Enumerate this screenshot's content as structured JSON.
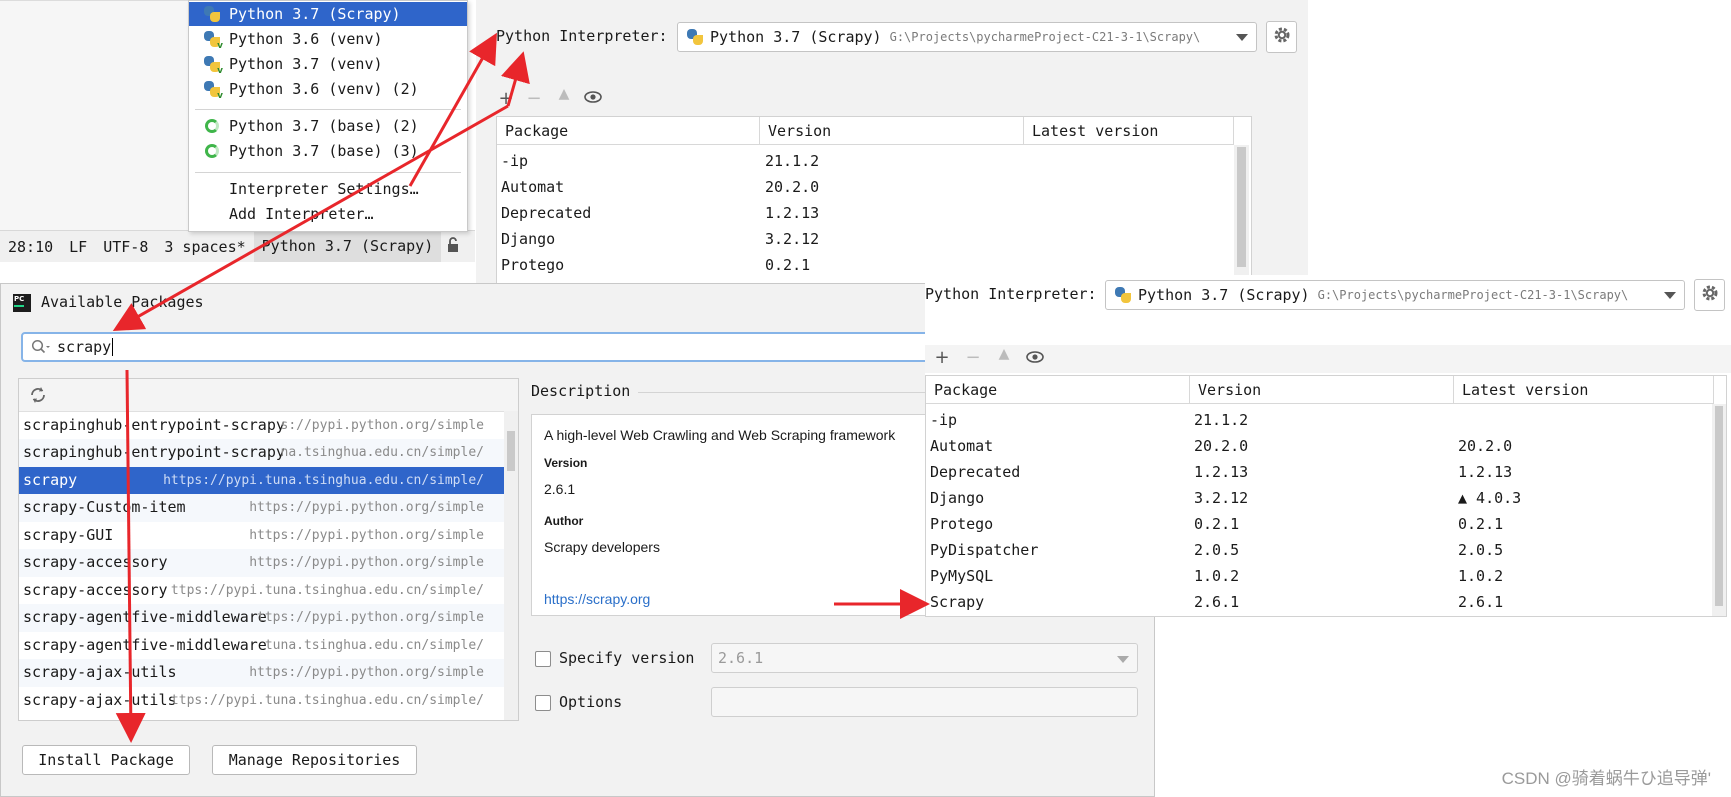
{
  "status_bar": {
    "position": "28:10",
    "line_sep": "LF",
    "encoding": "UTF-8",
    "indent": "3 spaces*",
    "interpreter": "Python 3.7 (Scrapy)"
  },
  "interpreter_menu": {
    "items": [
      {
        "label": "Python 3.7 (Scrapy)",
        "icon": "python-icon",
        "selected": true
      },
      {
        "label": "Python 3.6 (venv)",
        "icon": "python-venv-icon"
      },
      {
        "label": "Python 3.7 (venv)",
        "icon": "python-venv-icon"
      },
      {
        "label": "Python 3.6 (venv) (2)",
        "icon": "python-venv-icon"
      },
      {
        "label": "Python 3.7 (base) (2)",
        "icon": "conda-icon"
      },
      {
        "label": "Python 3.7 (base) (3)",
        "icon": "conda-icon"
      }
    ],
    "settings_label": "Interpreter Settings…",
    "add_label": "Add Interpreter…"
  },
  "settings_top": {
    "label": "Python Interpreter:",
    "interpreter": "Python 3.7 (Scrapy)",
    "path": "G:\\Projects\\pycharmeProject-C21-3-1\\Scrapy\\",
    "columns": [
      "Package",
      "Version",
      "Latest version"
    ],
    "rows": [
      {
        "name": "-ip",
        "version": "21.1.2",
        "latest": ""
      },
      {
        "name": "Automat",
        "version": "20.2.0",
        "latest": ""
      },
      {
        "name": "Deprecated",
        "version": "1.2.13",
        "latest": ""
      },
      {
        "name": "Django",
        "version": "3.2.12",
        "latest": ""
      },
      {
        "name": "Protego",
        "version": "0.2.1",
        "latest": ""
      }
    ]
  },
  "available_packages": {
    "title": "Available Packages",
    "search_value": "scrapy",
    "packages": [
      {
        "name": "scrapinghub-entrypoint-scrapy",
        "repo": "s://pypi.python.org/simple"
      },
      {
        "name": "scrapinghub-entrypoint-scrapy",
        "repo": "na.tsinghua.edu.cn/simple/"
      },
      {
        "name": "scrapy",
        "repo": "https://pypi.tuna.tsinghua.edu.cn/simple/"
      },
      {
        "name": "scrapy-Custom-item",
        "repo": "https://pypi.python.org/simple"
      },
      {
        "name": "scrapy-GUI",
        "repo": "https://pypi.python.org/simple"
      },
      {
        "name": "scrapy-accessory",
        "repo": "https://pypi.python.org/simple"
      },
      {
        "name": "scrapy-accessory",
        "repo": "ttps://pypi.tuna.tsinghua.edu.cn/simple/"
      },
      {
        "name": "scrapy-agentfive-middleware",
        "repo": "ttps://pypi.python.org/simple"
      },
      {
        "name": "scrapy-agentfive-middleware",
        "repo": "tuna.tsinghua.edu.cn/simple/"
      },
      {
        "name": "scrapy-ajax-utils",
        "repo": "https://pypi.python.org/simple"
      },
      {
        "name": "scrapy-ajax-utils",
        "repo": "ttps://pypi.tuna.tsinghua.edu.cn/simple/"
      }
    ],
    "selected_index": 2,
    "description_label": "Description",
    "description": "A high-level Web Crawling and Web Scraping framework",
    "version_heading": "Version",
    "version": "2.6.1",
    "author_heading": "Author",
    "author": "Scrapy developers",
    "link": "https://scrapy.org",
    "specify_version_label": "Specify version",
    "specify_version_value": "2.6.1",
    "options_label": "Options",
    "install_button": "Install Package",
    "manage_button": "Manage Repositories"
  },
  "settings_bottom": {
    "label": "Python Interpreter:",
    "interpreter": "Python 3.7 (Scrapy)",
    "path": "G:\\Projects\\pycharmeProject-C21-3-1\\Scrapy\\",
    "columns": [
      "Package",
      "Version",
      "Latest version"
    ],
    "rows": [
      {
        "name": "-ip",
        "version": "21.1.2",
        "latest": ""
      },
      {
        "name": "Automat",
        "version": "20.2.0",
        "latest": "20.2.0"
      },
      {
        "name": "Deprecated",
        "version": "1.2.13",
        "latest": "1.2.13"
      },
      {
        "name": "Django",
        "version": "3.2.12",
        "latest": "▲ 4.0.3"
      },
      {
        "name": "Protego",
        "version": "0.2.1",
        "latest": "0.2.1"
      },
      {
        "name": "PyDispatcher",
        "version": "2.0.5",
        "latest": "2.0.5"
      },
      {
        "name": "PyMySQL",
        "version": "1.0.2",
        "latest": "1.0.2"
      },
      {
        "name": "Scrapy",
        "version": "2.6.1",
        "latest": "2.6.1"
      }
    ]
  },
  "watermark": "CSDN @骑着蜗牛ひ追导弹'",
  "colors": {
    "selection": "#2f65ca",
    "arrow": "#e8262b",
    "link": "#2a6fc9"
  }
}
